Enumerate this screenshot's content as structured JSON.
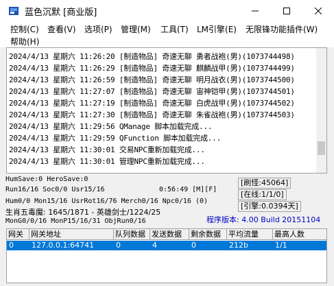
{
  "window": {
    "title": "蓝色沉默 [商业版]",
    "minimize_glyph": "—",
    "close_glyph": "✕"
  },
  "menu": [
    "控制(C)",
    "查看(V)",
    "选项(P)",
    "管理(M)",
    "工具(T)",
    "LM引擎(E)",
    "无限锋功能插件(W)",
    "帮助(H)"
  ],
  "log_lines": [
    "2024/4/13 星期六 11:26:20 [制造物品] 奇速无聊 勇者战袍(男)(1073744498)",
    "2024/4/13 星期六 11:26:29 [制造物品] 奇速无聊 麒麟战甲(男)(1073744499)",
    "2024/4/13 星期六 11:26:59 [制造物品] 奇速无聊 明月战衣(男)(1073744500)",
    "2024/4/13 星期六 11:27:07 [制造物品] 奇速无聊 宙神铠甲(男)(1073744501)",
    "2024/4/13 星期六 11:27:19 [制造物品] 奇速无聊 白虎战甲(男)(1073744502)",
    "2024/4/13 星期六 11:27:30 [制造物品] 奇速无聊 朱雀战袍(男)(1073744503)",
    "2024/4/13 星期六 11:29:56 QManage 脚本加载完成...",
    "2024/4/13 星期六 11:29:59 QFunction 脚本加载完成...",
    "2024/4/13 星期六 11:30:01 交易NPC重新加载完成...",
    "2024/4/13 星期六 11:30:01 管理NPC重新加载完成..."
  ],
  "status": {
    "line1": "HumSave:0 HeroSave:0",
    "line2": "Run16/16 Soc0/0 Usr15/16",
    "clock": "0:56:49 [M][F]",
    "line3": "Hum0/0 Mon15/16 UsrRot16/76 Merch0/16 Npc0/16 (0)",
    "line4": "生肖五毒魔: 1645/1871 - 英雄剑士/1224/25",
    "line5": "MonG0/0/16 MonP15/16/31 ObjRun0/16",
    "refresh": "[刷怪:45064]",
    "online": "[在线:1/1/0]",
    "engine": "[引擎:0.0394天]",
    "version": "程序版本: 4.00 Build 20151104"
  },
  "grid": {
    "headers": [
      "网关",
      "网关地址",
      "队列数据",
      "发送数据",
      "剩余数据",
      "平均流量",
      "最高人数"
    ],
    "rows": [
      [
        "0",
        "127.0.0.1:64741",
        "0",
        "4",
        "0",
        "212b",
        "1/1"
      ]
    ]
  },
  "colors": {
    "selection": "#0078d7",
    "version_text": "#0000c8"
  }
}
